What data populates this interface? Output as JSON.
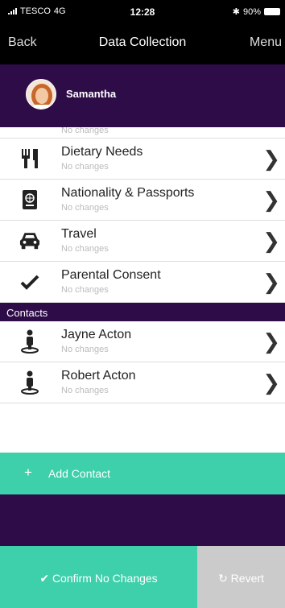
{
  "status": {
    "carrier": "TESCO",
    "network": "4G",
    "time": "12:28",
    "battery": "90%",
    "bluetooth": "✱"
  },
  "nav": {
    "back": "Back",
    "title": "Data Collection",
    "menu": "Menu"
  },
  "profile": {
    "name": "Samantha"
  },
  "partial_row": {
    "sub": "No changes"
  },
  "rows": [
    {
      "label": "Dietary Needs",
      "sub": "No changes",
      "icon": "utensils-icon"
    },
    {
      "label": "Nationality & Passports",
      "sub": "No changes",
      "icon": "passport-icon"
    },
    {
      "label": "Travel",
      "sub": "No changes",
      "icon": "car-icon"
    },
    {
      "label": "Parental Consent",
      "sub": "No changes",
      "icon": "checkmark-icon"
    }
  ],
  "contacts_section": "Contacts",
  "contacts": [
    {
      "label": "Jayne Acton",
      "sub": "No changes",
      "icon": "person-icon"
    },
    {
      "label": "Robert Acton",
      "sub": "No changes",
      "icon": "person-icon"
    }
  ],
  "add_contact": {
    "icon": "+",
    "label": "Add Contact"
  },
  "footer": {
    "confirm": "✔ Confirm No Changes",
    "revert": "↻ Revert"
  },
  "colors": {
    "purple": "#2e0c48",
    "teal": "#3ecfab",
    "grey": "#cbcbcb"
  }
}
